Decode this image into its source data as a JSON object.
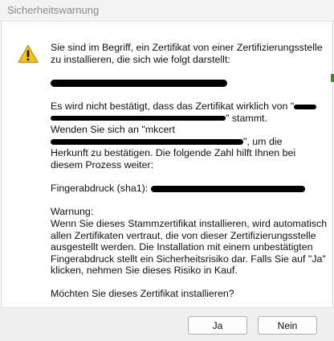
{
  "window": {
    "title": "Sicherheitswarnung"
  },
  "message": {
    "line1": "Sie sind im Begriff, ein Zertifikat von einer Zertifizierungsstelle",
    "line2": "zu installieren, die sich wie folgt darstellt:",
    "not_confirmed_prefix": "Es wird nicht bestätigt, dass das Zertifikat wirklich von \"",
    "not_confirmed_suffix": "\" stammt.",
    "contact_prefix": "Wenden Sie sich an \"mkcert",
    "contact_suffix": "\", um die",
    "origin_line": "Herkunft zu bestätigen. Die folgende Zahl hilft Ihnen bei",
    "process_line": "diesem Prozess weiter:",
    "fingerprint_label": "Fingerabdruck (sha1): ",
    "warning_heading": "Warnung:",
    "warning_line1": "Wenn Sie dieses Stammzertifikat installieren, wird automatisch",
    "warning_line2": "allen Zertifikaten vertraut, die von dieser Zertifizierungsstelle",
    "warning_line3": "ausgestellt werden. Die Installation mit einem unbestätigten",
    "warning_line4": "Fingerabdruck stellt ein Sicherheitsrisiko dar. Falls Sie auf \"Ja\"",
    "warning_line5": "klicken, nehmen Sie dieses Risiko in Kauf.",
    "question": "Möchten Sie dieses Zertifikat installieren?"
  },
  "buttons": {
    "yes": "Ja",
    "no": "Nein"
  },
  "icons": {
    "warning": "warning-triangle-icon"
  },
  "colors": {
    "warning_fill": "#f6c21c",
    "warning_border": "#c28b00",
    "redaction": "#000000"
  }
}
